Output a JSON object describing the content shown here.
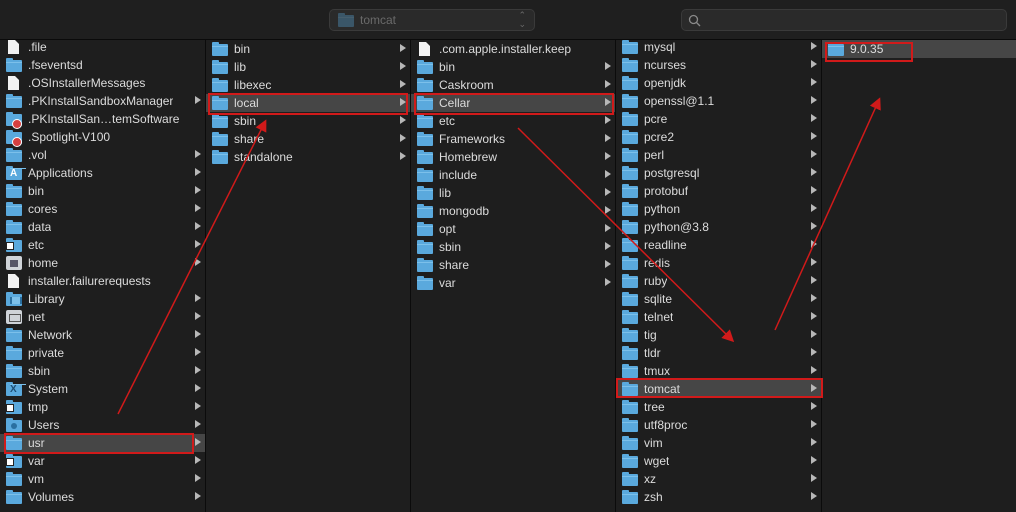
{
  "toolbar": {
    "path_title": "tomcat",
    "search_placeholder": "",
    "search_value": ""
  },
  "columns": [
    {
      "id": "root",
      "items": [
        {
          "label": ".file",
          "icon": "file",
          "arrow": false
        },
        {
          "label": ".fseventsd",
          "icon": "folder",
          "arrow": false
        },
        {
          "label": ".OSInstallerMessages",
          "icon": "file",
          "arrow": false
        },
        {
          "label": ".PKInstallSandboxManager",
          "icon": "folder",
          "arrow": true
        },
        {
          "label": ".PKInstallSan…temSoftware",
          "icon": "folder-badge",
          "arrow": false
        },
        {
          "label": ".Spotlight-V100",
          "icon": "folder-badge",
          "arrow": false
        },
        {
          "label": ".vol",
          "icon": "folder",
          "arrow": true
        },
        {
          "label": "Applications",
          "icon": "applications",
          "arrow": true
        },
        {
          "label": "bin",
          "icon": "folder",
          "arrow": true
        },
        {
          "label": "cores",
          "icon": "folder",
          "arrow": true
        },
        {
          "label": "data",
          "icon": "folder",
          "arrow": true
        },
        {
          "label": "etc",
          "icon": "folder-alias",
          "arrow": true
        },
        {
          "label": "home",
          "icon": "home",
          "arrow": true
        },
        {
          "label": "installer.failurerequests",
          "icon": "file",
          "arrow": false
        },
        {
          "label": "Library",
          "icon": "library",
          "arrow": true
        },
        {
          "label": "net",
          "icon": "net",
          "arrow": true
        },
        {
          "label": "Network",
          "icon": "folder",
          "arrow": true
        },
        {
          "label": "private",
          "icon": "folder",
          "arrow": true
        },
        {
          "label": "sbin",
          "icon": "folder",
          "arrow": true
        },
        {
          "label": "System",
          "icon": "system",
          "arrow": true
        },
        {
          "label": "tmp",
          "icon": "folder-alias",
          "arrow": true
        },
        {
          "label": "Users",
          "icon": "users",
          "arrow": true
        },
        {
          "label": "usr",
          "icon": "folder",
          "arrow": true,
          "selected": true
        },
        {
          "label": "var",
          "icon": "folder-alias",
          "arrow": true
        },
        {
          "label": "vm",
          "icon": "folder",
          "arrow": true
        },
        {
          "label": "Volumes",
          "icon": "folder",
          "arrow": true
        }
      ]
    },
    {
      "id": "usr",
      "items": [
        {
          "label": "bin",
          "icon": "folder",
          "arrow": true
        },
        {
          "label": "lib",
          "icon": "folder",
          "arrow": true
        },
        {
          "label": "libexec",
          "icon": "folder",
          "arrow": true
        },
        {
          "label": "local",
          "icon": "folder",
          "arrow": true,
          "selected": true
        },
        {
          "label": "sbin",
          "icon": "folder",
          "arrow": true
        },
        {
          "label": "share",
          "icon": "folder",
          "arrow": true
        },
        {
          "label": "standalone",
          "icon": "folder",
          "arrow": true
        }
      ]
    },
    {
      "id": "local",
      "items": [
        {
          "label": ".com.apple.installer.keep",
          "icon": "file",
          "arrow": false
        },
        {
          "label": "bin",
          "icon": "folder",
          "arrow": true
        },
        {
          "label": "Caskroom",
          "icon": "folder",
          "arrow": true
        },
        {
          "label": "Cellar",
          "icon": "folder",
          "arrow": true,
          "selected": true
        },
        {
          "label": "etc",
          "icon": "folder",
          "arrow": true
        },
        {
          "label": "Frameworks",
          "icon": "folder",
          "arrow": true
        },
        {
          "label": "Homebrew",
          "icon": "folder",
          "arrow": true
        },
        {
          "label": "include",
          "icon": "folder",
          "arrow": true
        },
        {
          "label": "lib",
          "icon": "folder",
          "arrow": true
        },
        {
          "label": "mongodb",
          "icon": "folder",
          "arrow": true
        },
        {
          "label": "opt",
          "icon": "folder",
          "arrow": true
        },
        {
          "label": "sbin",
          "icon": "folder",
          "arrow": true
        },
        {
          "label": "share",
          "icon": "folder",
          "arrow": true
        },
        {
          "label": "var",
          "icon": "folder",
          "arrow": true
        }
      ]
    },
    {
      "id": "cellar",
      "items": [
        {
          "label": "mysql",
          "icon": "folder",
          "arrow": true
        },
        {
          "label": "ncurses",
          "icon": "folder",
          "arrow": true
        },
        {
          "label": "openjdk",
          "icon": "folder",
          "arrow": true
        },
        {
          "label": "openssl@1.1",
          "icon": "folder",
          "arrow": true
        },
        {
          "label": "pcre",
          "icon": "folder",
          "arrow": true
        },
        {
          "label": "pcre2",
          "icon": "folder",
          "arrow": true
        },
        {
          "label": "perl",
          "icon": "folder",
          "arrow": true
        },
        {
          "label": "postgresql",
          "icon": "folder",
          "arrow": true
        },
        {
          "label": "protobuf",
          "icon": "folder",
          "arrow": true
        },
        {
          "label": "python",
          "icon": "folder",
          "arrow": true
        },
        {
          "label": "python@3.8",
          "icon": "folder",
          "arrow": true
        },
        {
          "label": "readline",
          "icon": "folder",
          "arrow": true
        },
        {
          "label": "redis",
          "icon": "folder",
          "arrow": true
        },
        {
          "label": "ruby",
          "icon": "folder",
          "arrow": true
        },
        {
          "label": "sqlite",
          "icon": "folder",
          "arrow": true
        },
        {
          "label": "telnet",
          "icon": "folder",
          "arrow": true
        },
        {
          "label": "tig",
          "icon": "folder",
          "arrow": true
        },
        {
          "label": "tldr",
          "icon": "folder",
          "arrow": true
        },
        {
          "label": "tmux",
          "icon": "folder",
          "arrow": true
        },
        {
          "label": "tomcat",
          "icon": "folder",
          "arrow": true,
          "selected": true
        },
        {
          "label": "tree",
          "icon": "folder",
          "arrow": true
        },
        {
          "label": "utf8proc",
          "icon": "folder",
          "arrow": true
        },
        {
          "label": "vim",
          "icon": "folder",
          "arrow": true
        },
        {
          "label": "wget",
          "icon": "folder",
          "arrow": true
        },
        {
          "label": "xz",
          "icon": "folder",
          "arrow": true
        },
        {
          "label": "zsh",
          "icon": "folder",
          "arrow": true
        }
      ]
    },
    {
      "id": "tomcat",
      "items": [
        {
          "label": "9.0.35",
          "icon": "folder",
          "arrow": false,
          "selected": true
        }
      ]
    }
  ],
  "colors": {
    "annotation": "#d11a1a",
    "folder": "#5aa9dd",
    "selection": "#464646",
    "background": "#1e1e1e"
  }
}
